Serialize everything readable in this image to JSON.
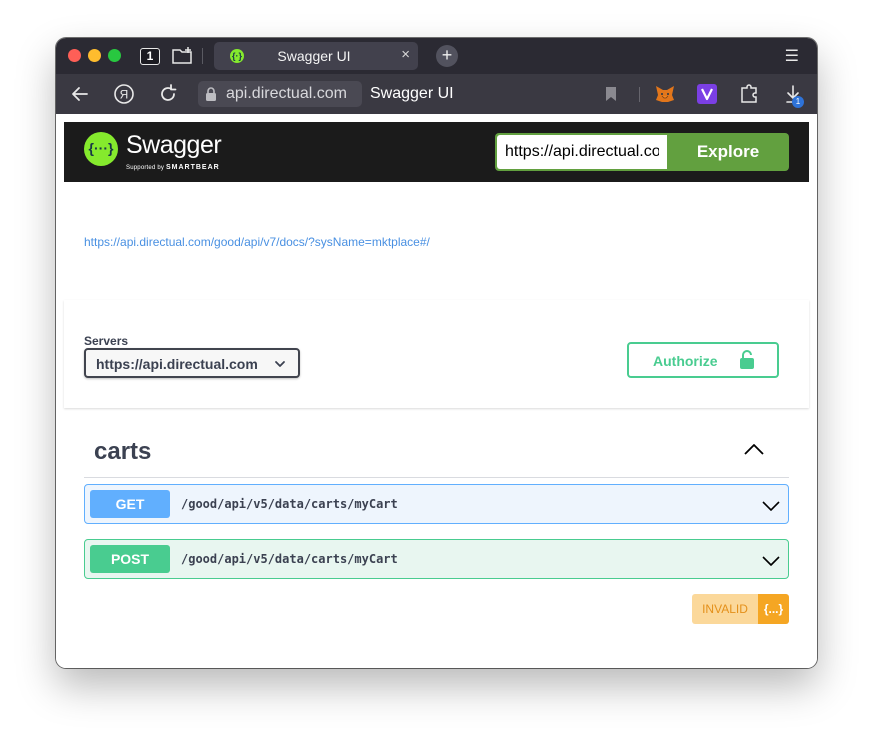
{
  "browser": {
    "tab_count": "1",
    "tab_title": "Swagger UI",
    "tab_close": "×",
    "new_tab": "+",
    "menu": "☰",
    "url": "api.directual.com",
    "page_title": "Swagger UI",
    "download_badge": "1",
    "favicon_glyph": "{·}"
  },
  "swagger": {
    "logo_glyph": "{···}",
    "logo_name": "Swagger",
    "logo_tag_prefix": "Supported by",
    "logo_tag_brand": "SMARTBEAR",
    "explore_input": "https://api.directual.com/good/api/v7/docs/?sysName=mktplace#/",
    "explore_button": "Explore",
    "brand_green": "#85ea2d"
  },
  "info": {
    "url": "https://api.directual.com/good/api/v7/docs/?sysName=mktplace#/"
  },
  "servers": {
    "label": "Servers",
    "selected": "https://api.directual.com",
    "authorize_label": "Authorize"
  },
  "tag": {
    "name": "carts"
  },
  "operations": [
    {
      "method": "GET",
      "path": "/good/api/v5/data/carts/myCart",
      "color": "#61affe"
    },
    {
      "method": "POST",
      "path": "/good/api/v5/data/carts/myCart",
      "color": "#49cc90"
    }
  ],
  "validator": {
    "status": "INVALID",
    "badge": "{...}"
  }
}
